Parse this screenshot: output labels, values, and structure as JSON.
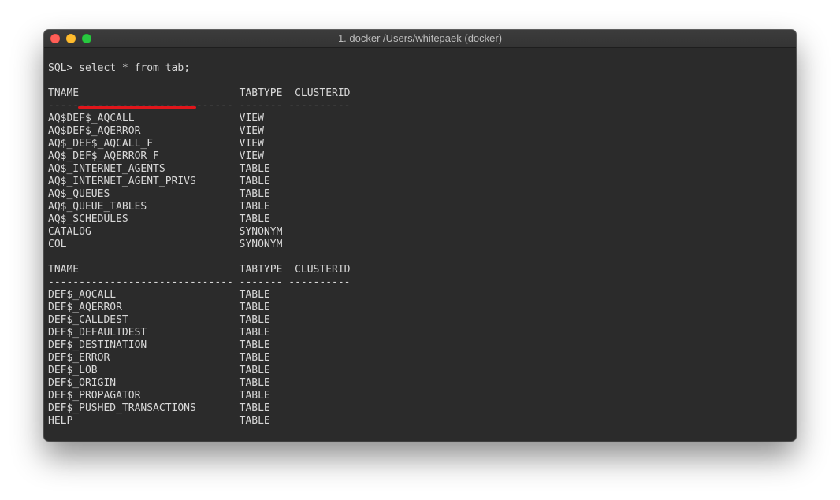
{
  "window": {
    "title": "1. docker /Users/whitepaek (docker)"
  },
  "terminal": {
    "prompt": "SQL> ",
    "command": "select * from tab;",
    "header": "TNAME                          TABTYPE  CLUSTERID",
    "divider": "------------------------------ ------- ----------",
    "block1": [
      "AQ$DEF$_AQCALL                 VIEW",
      "AQ$DEF$_AQERROR                VIEW",
      "AQ$_DEF$_AQCALL_F              VIEW",
      "AQ$_DEF$_AQERROR_F             VIEW",
      "AQ$_INTERNET_AGENTS            TABLE",
      "AQ$_INTERNET_AGENT_PRIVS       TABLE",
      "AQ$_QUEUES                     TABLE",
      "AQ$_QUEUE_TABLES               TABLE",
      "AQ$_SCHEDULES                  TABLE",
      "CATALOG                        SYNONYM",
      "COL                            SYNONYM"
    ],
    "block2": [
      "DEF$_AQCALL                    TABLE",
      "DEF$_AQERROR                   TABLE",
      "DEF$_CALLDEST                  TABLE",
      "DEF$_DEFAULTDEST               TABLE",
      "DEF$_DESTINATION               TABLE",
      "DEF$_ERROR                     TABLE",
      "DEF$_LOB                       TABLE",
      "DEF$_ORIGIN                    TABLE",
      "DEF$_PROPAGATOR                TABLE",
      "DEF$_PUSHED_TRANSACTIONS       TABLE",
      "HELP                           TABLE"
    ],
    "highlight_color": "#e0161b"
  }
}
